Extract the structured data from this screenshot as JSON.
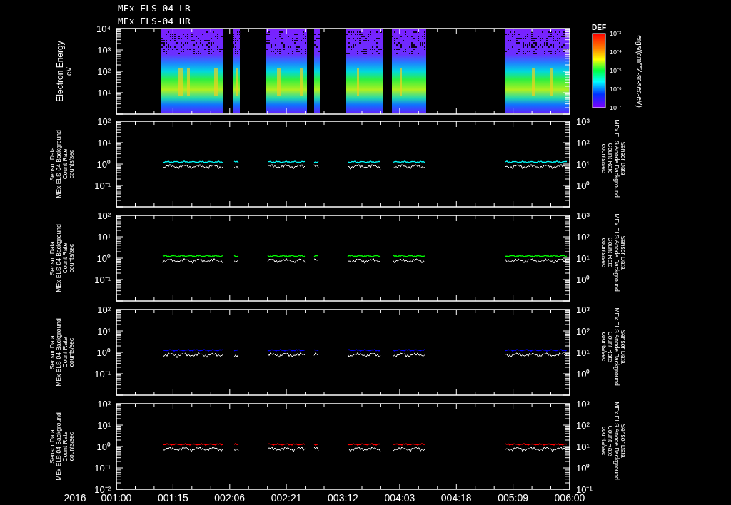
{
  "titles": [
    "MEx ELS-04 LR",
    "MEx ELS-04 HR"
  ],
  "spectrogram": {
    "ylabel": "Electron Energy",
    "yunit": "eV",
    "yticks": [
      "10⁴",
      "10³",
      "10²",
      "10¹"
    ],
    "colorbar": {
      "title": "DEF",
      "ticks": [
        "10⁻³",
        "10⁻⁴",
        "10⁻⁵",
        "10⁻⁶",
        "10⁻⁷"
      ],
      "unit": "ergs/(cm**2-sr-sec-eV)"
    }
  },
  "panels": [
    {
      "color": "#00ffff",
      "left_label": [
        "Sensor Data",
        "MEx ELS-04 Background",
        "Count Rate",
        "counts/sec"
      ],
      "right_label": [
        "Sensor Data",
        "MEx ELS Anode Background",
        "Count Rate",
        "counts/sec"
      ],
      "left_ticks": [
        "10²",
        "10¹",
        "10⁰",
        "10⁻¹"
      ],
      "right_ticks": [
        "10³",
        "10²",
        "10¹",
        "10⁰"
      ]
    },
    {
      "color": "#00ff00",
      "left_label": [
        "Sensor Data",
        "MEx ELS-04 Background",
        "Count Rate",
        "counts/sec"
      ],
      "right_label": [
        "Sensor Data",
        "MEx ELS Anode Background",
        "Count Rate",
        "counts/sec"
      ],
      "left_ticks": [
        "10²",
        "10¹",
        "10⁰",
        "10⁻¹"
      ],
      "right_ticks": [
        "10³",
        "10²",
        "10¹",
        "10⁰"
      ]
    },
    {
      "color": "#0000ff",
      "left_label": [
        "Sensor Data",
        "MEx ELS-04 Background",
        "Count Rate",
        "counts/sec"
      ],
      "right_label": [
        "Sensor Data",
        "MEx ELS Anode Background",
        "Count Rate",
        "counts/sec"
      ],
      "left_ticks": [
        "10²",
        "10¹",
        "10⁰",
        "10⁻¹"
      ],
      "right_ticks": [
        "10³",
        "10²",
        "10¹",
        "10⁰"
      ]
    },
    {
      "color": "#ff0000",
      "left_label": [
        "Sensor Data",
        "MEx ELS-04 Background",
        "Count Rate",
        "counts/sec"
      ],
      "right_label": [
        "Sensor Data",
        "MEx ELS Anode Background",
        "Count Rate",
        "counts/sec"
      ],
      "left_ticks": [
        "10²",
        "10¹",
        "10⁰",
        "10⁻¹",
        "10⁻²"
      ],
      "right_ticks": [
        "10³",
        "10²",
        "10¹",
        "10⁰",
        "10⁻¹"
      ]
    }
  ],
  "x_axis": {
    "year": "2016",
    "ticks": [
      "001:00",
      "001:15",
      "002:06",
      "002:21",
      "003:12",
      "004:03",
      "004:18",
      "005:09",
      "006:00"
    ]
  }
}
